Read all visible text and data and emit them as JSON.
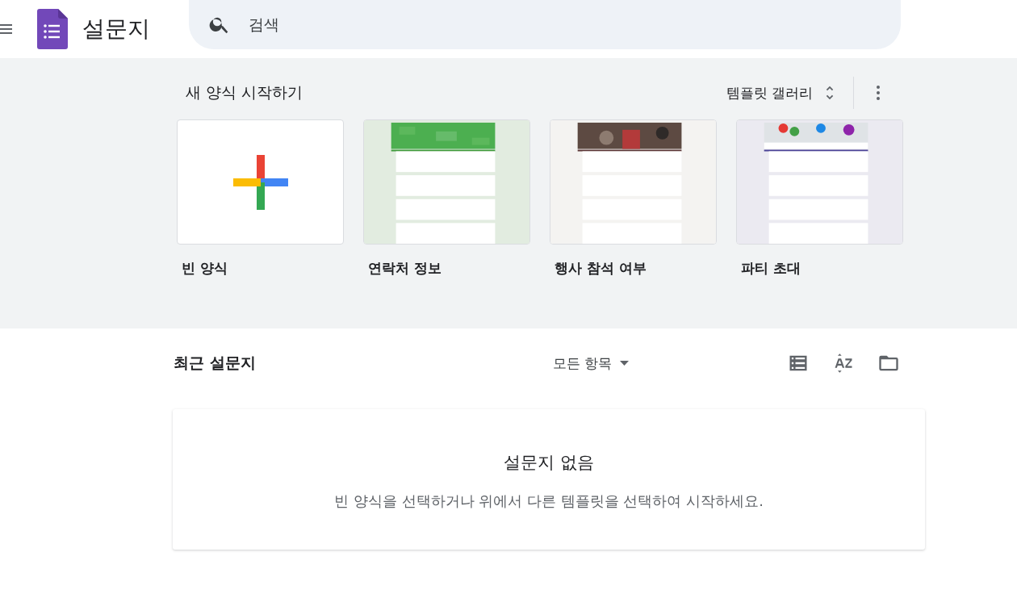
{
  "header": {
    "app_title": "설문지",
    "search": {
      "placeholder": "검색"
    }
  },
  "templates": {
    "title": "새 양식 시작하기",
    "gallery_button": "템플릿 갤러리",
    "items": [
      {
        "label": "빈 양식",
        "kind": "blank"
      },
      {
        "label": "연락처 정보",
        "kind": "picture"
      },
      {
        "label": "행사 참석 여부",
        "kind": "picture"
      },
      {
        "label": "파티 초대",
        "kind": "picture"
      }
    ]
  },
  "recent": {
    "title": "최근 설문지",
    "owner_filter": "모든 항목",
    "empty_title": "설문지 없음",
    "empty_message": "빈 양식을 선택하거나 위에서 다른 템플릿을 선택하여 시작하세요."
  }
}
